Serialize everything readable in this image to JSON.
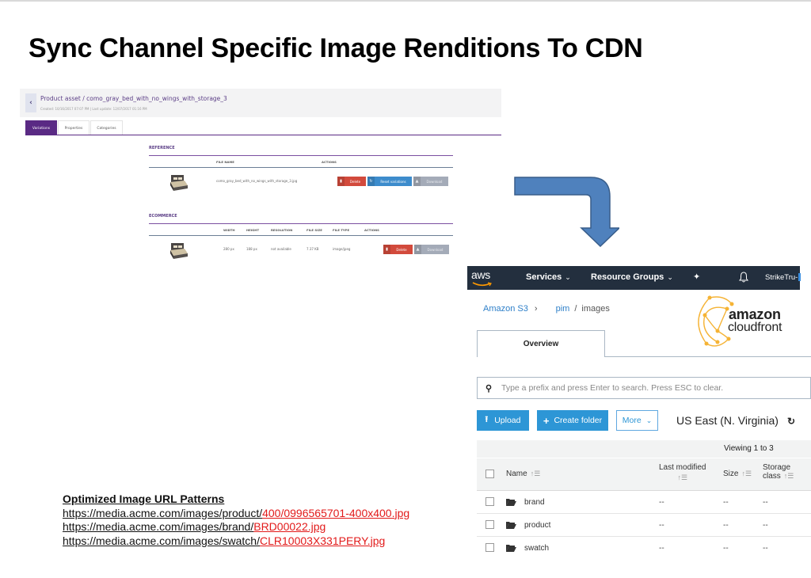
{
  "slide": {
    "title": "Sync Channel Specific Image Renditions To CDN"
  },
  "pim": {
    "back_icon": "chevron-left-icon",
    "asset_title": "Product asset / como_gray_bed_with_no_wings_with_storage_3",
    "asset_meta": "Created: 10/16/2017 07:07 PM | Last update: 12/07/2017 01:16 PM",
    "tabs": [
      {
        "label": "Variations",
        "active": true
      },
      {
        "label": "Properties",
        "active": false
      },
      {
        "label": "Categories",
        "active": false
      }
    ],
    "reference": {
      "title": "REFERENCE",
      "columns": [
        "FILE NAME",
        "ACTIONS"
      ],
      "row": {
        "thumbnail": "bed-image",
        "file_name": "como_gray_bed_with_no_wings_with_storage_3.jpg",
        "actions": [
          {
            "label": "Delete",
            "icon": "trash-icon",
            "color": "#d24a3c"
          },
          {
            "label": "Reset variations",
            "icon": "refresh-icon",
            "color": "#3d8ccc"
          },
          {
            "label": "Download",
            "icon": "download-icon",
            "color": "#a4abb8"
          }
        ]
      }
    },
    "ecommerce": {
      "title": "ECOMMERCE",
      "columns": [
        "WIDTH",
        "HEIGHT",
        "RESOLUTION",
        "FILE SIZE",
        "FILE TYPE",
        "ACTIONS"
      ],
      "row": {
        "thumbnail": "bed-image",
        "width": "280 px",
        "height": "188 px",
        "resolution": "not available",
        "file_size": "7.37 KB",
        "file_type": "image/jpeg",
        "actions": [
          {
            "label": "Delete",
            "icon": "trash-icon",
            "color": "#d24a3c"
          },
          {
            "label": "Download",
            "icon": "download-icon",
            "color": "#a4abb8"
          }
        ]
      }
    },
    "accent_color": "#5a2a84"
  },
  "arrow": {
    "color": "#4f81bd",
    "direction": "right-then-down"
  },
  "aws": {
    "nav": {
      "logo": "aws",
      "services": "Services",
      "resource_groups": "Resource Groups",
      "chevron": "⌄",
      "pin_icon": "pin-icon",
      "bell_icon": "bell-icon",
      "user": "StrikeTru-"
    },
    "breadcrumb": {
      "root": "Amazon S3",
      "separator": "›",
      "bucket": "pim",
      "slash": "/",
      "folder": "images"
    },
    "cloudfront_logo": {
      "line1": "amazon",
      "line2": "cloudfront"
    },
    "tab": "Overview",
    "search": {
      "placeholder": "Type a prefix and press Enter to search. Press ESC to clear."
    },
    "buttons": {
      "upload": "Upload",
      "create_folder": "Create folder",
      "more": "More"
    },
    "region": "US East (N. Virginia)",
    "viewing": "Viewing 1 to 3",
    "columns": {
      "name": "Name",
      "last_modified": "Last modified",
      "size": "Size",
      "storage_class_1": "Storage",
      "storage_class_2": "class"
    },
    "rows": [
      {
        "name": "brand",
        "last_modified": "--",
        "size": "--",
        "storage_class": "--"
      },
      {
        "name": "product",
        "last_modified": "--",
        "size": "--",
        "storage_class": "--"
      },
      {
        "name": "swatch",
        "last_modified": "--",
        "size": "--",
        "storage_class": "--"
      }
    ],
    "nav_color": "#232f3e",
    "primary_color": "#2d96d6"
  },
  "url_patterns": {
    "heading": "Optimized Image URL Patterns",
    "lines": [
      {
        "base": "https://media.acme.com/images/product/",
        "highlight": "400/0996565701-400x400.jpg"
      },
      {
        "base": "https://media.acme.com/images/brand/",
        "highlight": "BRD00022.jpg"
      },
      {
        "base": "https://media.acme.com/images/swatch/",
        "highlight": "CLR10003X331PERY.jpg"
      }
    ],
    "highlight_color": "#e21a1a"
  }
}
